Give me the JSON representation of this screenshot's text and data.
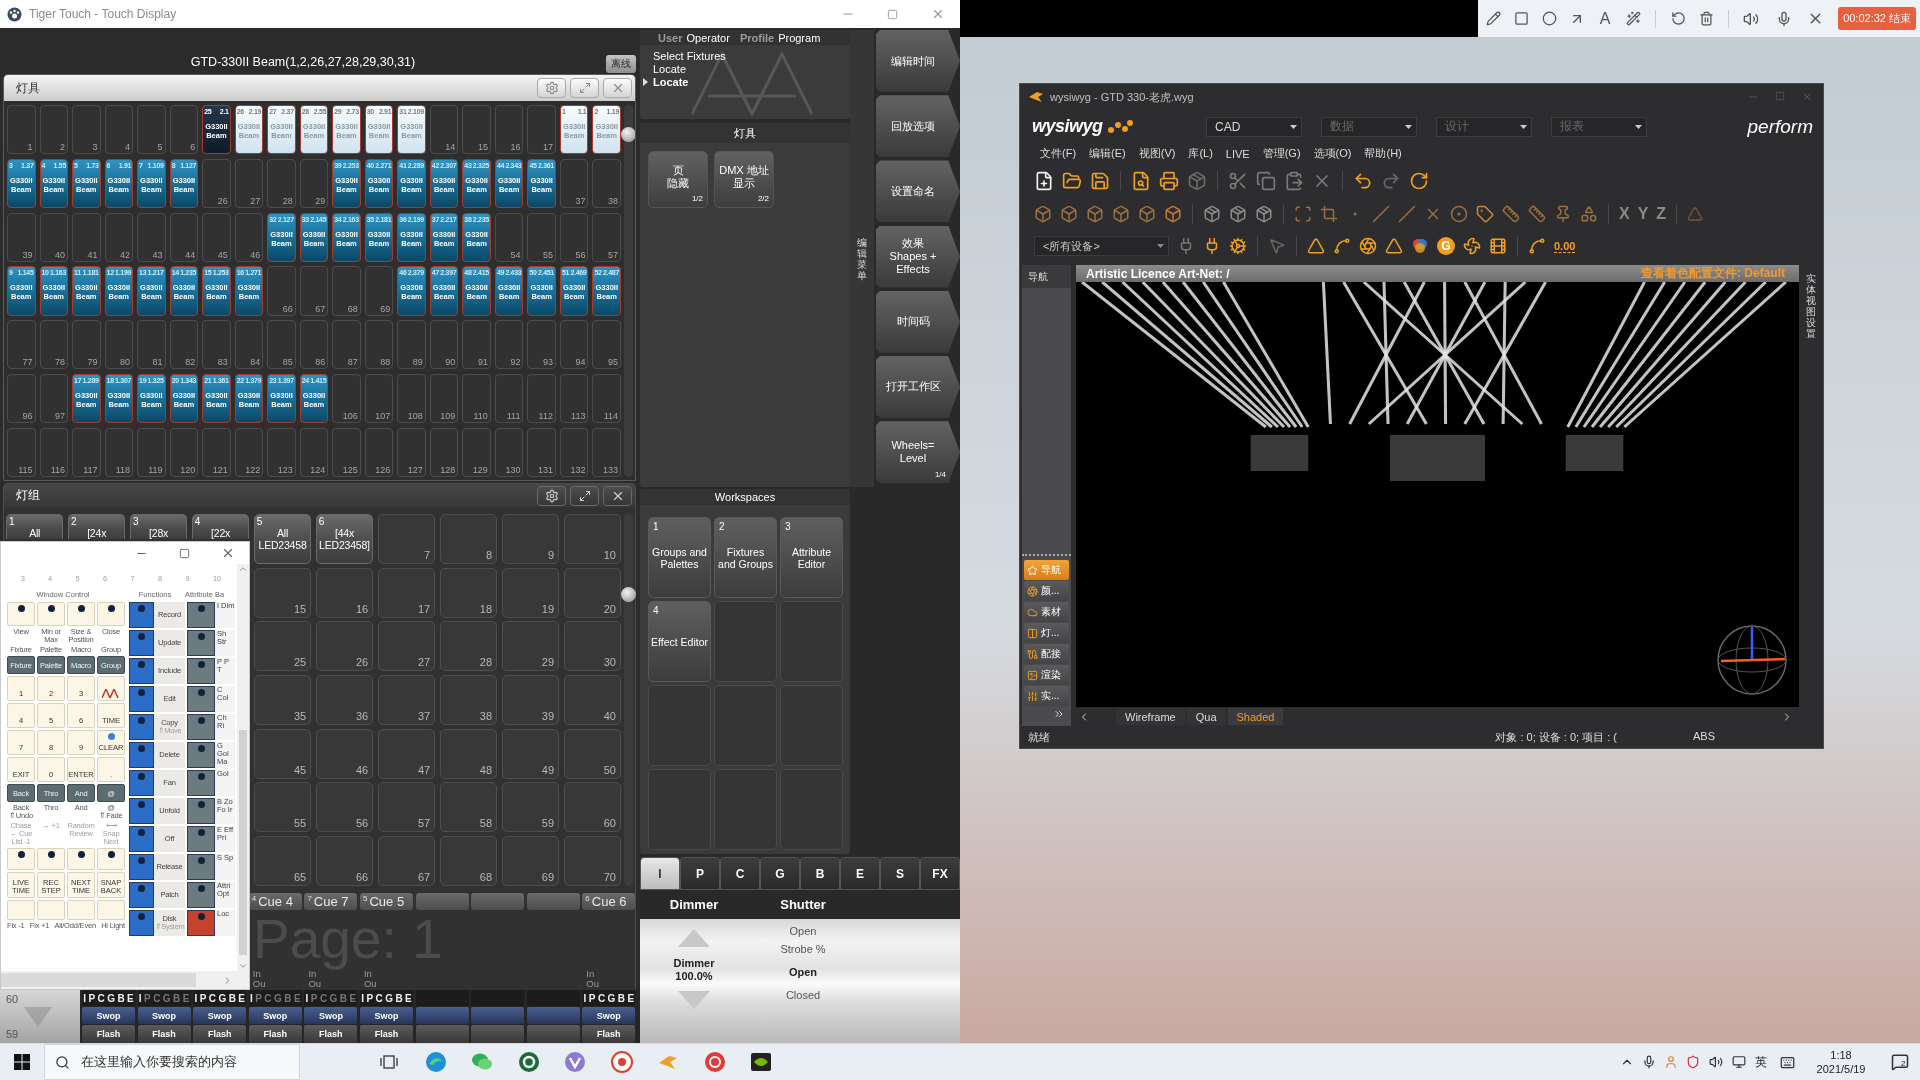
{
  "app_window": {
    "title": "Tiger Touch - Touch Display",
    "selection": "GTD-330II Beam(1,2,26,27,28,29,30,31)",
    "offline_button": "离线"
  },
  "fixtures_window": {
    "title": "灯具",
    "cells": [
      {
        "kind": "empty",
        "number": "1"
      },
      {
        "kind": "empty",
        "number": "2"
      },
      {
        "kind": "empty",
        "number": "3"
      },
      {
        "kind": "empty",
        "number": "4"
      },
      {
        "kind": "empty",
        "number": "5"
      },
      {
        "kind": "empty",
        "number": "6"
      },
      {
        "kind": "fixture",
        "id": "25",
        "address": "2.1",
        "type": "G330II",
        "mode": "Beam",
        "selected": false,
        "current": true
      },
      {
        "kind": "fixture",
        "id": "26",
        "address": "2.19",
        "type": "G330II",
        "mode": "Beam",
        "selected": true,
        "current": false
      },
      {
        "kind": "fixture",
        "id": "27",
        "address": "2.37",
        "type": "G330II",
        "mode": "Beam",
        "selected": true,
        "current": false
      },
      {
        "kind": "fixture",
        "id": "28",
        "address": "2.55",
        "type": "G330II",
        "mode": "Beam",
        "selected": true,
        "current": false
      },
      {
        "kind": "fixture",
        "id": "29",
        "address": "2.73",
        "type": "G330II",
        "mode": "Beam",
        "selected": true,
        "current": false
      },
      {
        "kind": "fixture",
        "id": "30",
        "address": "2.91",
        "type": "G330II",
        "mode": "Beam",
        "selected": true,
        "current": false
      },
      {
        "kind": "fixture",
        "id": "31",
        "address": "2.109",
        "type": "G330II",
        "mode": "Beam",
        "selected": true,
        "current": false
      },
      {
        "kind": "empty",
        "number": "14"
      },
      {
        "kind": "empty",
        "number": "15"
      },
      {
        "kind": "empty",
        "number": "16"
      },
      {
        "kind": "empty",
        "number": "17"
      },
      {
        "kind": "fixture",
        "id": "1",
        "address": "1.1",
        "type": "G330II",
        "mode": "Beam",
        "selected": true,
        "current": false
      },
      {
        "kind": "fixture",
        "id": "2",
        "address": "1.19",
        "type": "G330II",
        "mode": "Beam",
        "selected": true,
        "current": false
      },
      {
        "kind": "fixture",
        "id": "3",
        "address": "1.37",
        "type": "G330II",
        "mode": "Beam",
        "selected": false,
        "current": false
      },
      {
        "kind": "fixture",
        "id": "4",
        "address": "1.55",
        "type": "G330II",
        "mode": "Beam",
        "selected": false,
        "current": false
      },
      {
        "kind": "fixture",
        "id": "5",
        "address": "1.73",
        "type": "G330II",
        "mode": "Beam",
        "selected": false,
        "current": false
      },
      {
        "kind": "fixture",
        "id": "6",
        "address": "1.91",
        "type": "G330II",
        "mode": "Beam",
        "selected": false,
        "current": false
      },
      {
        "kind": "fixture",
        "id": "7",
        "address": "1.109",
        "type": "G330II",
        "mode": "Beam",
        "selected": false,
        "current": false
      },
      {
        "kind": "fixture",
        "id": "8",
        "address": "1.127",
        "type": "G330II",
        "mode": "Beam",
        "selected": false,
        "current": false
      },
      {
        "kind": "empty",
        "number": "26"
      },
      {
        "kind": "empty",
        "number": "27"
      },
      {
        "kind": "empty",
        "number": "28"
      },
      {
        "kind": "empty",
        "number": "29"
      },
      {
        "kind": "fixture",
        "id": "39",
        "address": "2.253",
        "type": "G330II",
        "mode": "Beam",
        "selected": false,
        "current": false
      },
      {
        "kind": "fixture",
        "id": "40",
        "address": "2.271",
        "type": "G330II",
        "mode": "Beam",
        "selected": false,
        "current": false
      },
      {
        "kind": "fixture",
        "id": "41",
        "address": "2.289",
        "type": "G330II",
        "mode": "Beam",
        "selected": false,
        "current": false
      },
      {
        "kind": "fixture",
        "id": "42",
        "address": "2.307",
        "type": "G330II",
        "mode": "Beam",
        "selected": false,
        "current": false
      },
      {
        "kind": "fixture",
        "id": "43",
        "address": "2.325",
        "type": "G330II",
        "mode": "Beam",
        "selected": false,
        "current": false
      },
      {
        "kind": "fixture",
        "id": "44",
        "address": "2.343",
        "type": "G330II",
        "mode": "Beam",
        "selected": false,
        "current": false
      },
      {
        "kind": "fixture",
        "id": "45",
        "address": "2.361",
        "type": "G330II",
        "mode": "Beam",
        "selected": false,
        "current": false
      },
      {
        "kind": "empty",
        "number": "37"
      },
      {
        "kind": "empty",
        "number": "38"
      },
      {
        "kind": "empty",
        "number": "39"
      },
      {
        "kind": "empty",
        "number": "40"
      },
      {
        "kind": "empty",
        "number": "41"
      },
      {
        "kind": "empty",
        "number": "42"
      },
      {
        "kind": "empty",
        "number": "43"
      },
      {
        "kind": "empty",
        "number": "44"
      },
      {
        "kind": "empty",
        "number": "45"
      },
      {
        "kind": "empty",
        "number": "46"
      },
      {
        "kind": "fixture",
        "id": "32",
        "address": "2.127",
        "type": "G330II",
        "mode": "Beam",
        "selected": false,
        "current": false
      },
      {
        "kind": "fixture",
        "id": "33",
        "address": "2.145",
        "type": "G330II",
        "mode": "Beam",
        "selected": false,
        "current": false
      },
      {
        "kind": "fixture",
        "id": "34",
        "address": "2.163",
        "type": "G330II",
        "mode": "Beam",
        "selected": false,
        "current": false
      },
      {
        "kind": "fixture",
        "id": "35",
        "address": "2.181",
        "type": "G330II",
        "mode": "Beam",
        "selected": false,
        "current": false
      },
      {
        "kind": "fixture",
        "id": "36",
        "address": "2.199",
        "type": "G330II",
        "mode": "Beam",
        "selected": false,
        "current": false
      },
      {
        "kind": "fixture",
        "id": "37",
        "address": "2.217",
        "type": "G330II",
        "mode": "Beam",
        "selected": false,
        "current": false
      },
      {
        "kind": "fixture",
        "id": "38",
        "address": "2.235",
        "type": "G330II",
        "mode": "Beam",
        "selected": false,
        "current": false
      },
      {
        "kind": "empty",
        "number": "54"
      },
      {
        "kind": "empty",
        "number": "55"
      },
      {
        "kind": "empty",
        "number": "56"
      },
      {
        "kind": "empty",
        "number": "57"
      },
      {
        "kind": "fixture",
        "id": "9",
        "address": "1.145",
        "type": "G330II",
        "mode": "Beam",
        "selected": false,
        "current": false
      },
      {
        "kind": "fixture",
        "id": "10",
        "address": "1.163",
        "type": "G330II",
        "mode": "Beam",
        "selected": false,
        "current": false
      },
      {
        "kind": "fixture",
        "id": "11",
        "address": "1.181",
        "type": "G330II",
        "mode": "Beam",
        "selected": false,
        "current": false
      },
      {
        "kind": "fixture",
        "id": "12",
        "address": "1.199",
        "type": "G330II",
        "mode": "Beam",
        "selected": false,
        "current": false
      },
      {
        "kind": "fixture",
        "id": "13",
        "address": "1.217",
        "type": "G330II",
        "mode": "Beam",
        "selected": false,
        "current": false
      },
      {
        "kind": "fixture",
        "id": "14",
        "address": "1.235",
        "type": "G330II",
        "mode": "Beam",
        "selected": false,
        "current": false
      },
      {
        "kind": "fixture",
        "id": "15",
        "address": "1.253",
        "type": "G330II",
        "mode": "Beam",
        "selected": false,
        "current": false
      },
      {
        "kind": "fixture",
        "id": "16",
        "address": "1.271",
        "type": "G330II",
        "mode": "Beam",
        "selected": false,
        "current": false
      },
      {
        "kind": "empty",
        "number": "66"
      },
      {
        "kind": "empty",
        "number": "67"
      },
      {
        "kind": "empty",
        "number": "68"
      },
      {
        "kind": "empty",
        "number": "69"
      },
      {
        "kind": "fixture",
        "id": "46",
        "address": "2.379",
        "type": "G330II",
        "mode": "Beam",
        "selected": false,
        "current": false
      },
      {
        "kind": "fixture",
        "id": "47",
        "address": "2.397",
        "type": "G330II",
        "mode": "Beam",
        "selected": false,
        "current": false
      },
      {
        "kind": "fixture",
        "id": "48",
        "address": "2.415",
        "type": "G330II",
        "mode": "Beam",
        "selected": false,
        "current": false
      },
      {
        "kind": "fixture",
        "id": "49",
        "address": "2.433",
        "type": "G330II",
        "mode": "Beam",
        "selected": false,
        "current": false
      },
      {
        "kind": "fixture",
        "id": "50",
        "address": "2.451",
        "type": "G330II",
        "mode": "Beam",
        "selected": false,
        "current": false
      },
      {
        "kind": "fixture",
        "id": "51",
        "address": "2.469",
        "type": "G330II",
        "mode": "Beam",
        "selected": false,
        "current": false
      },
      {
        "kind": "fixture",
        "id": "52",
        "address": "2.487",
        "type": "G330II",
        "mode": "Beam",
        "selected": false,
        "current": false
      },
      {
        "kind": "empty",
        "number": "77"
      },
      {
        "kind": "empty",
        "number": "78"
      },
      {
        "kind": "empty",
        "number": "79"
      },
      {
        "kind": "empty",
        "number": "80"
      },
      {
        "kind": "empty",
        "number": "81"
      },
      {
        "kind": "empty",
        "number": "82"
      },
      {
        "kind": "empty",
        "number": "83"
      },
      {
        "kind": "empty",
        "number": "84"
      },
      {
        "kind": "empty",
        "number": "85"
      },
      {
        "kind": "empty",
        "number": "86"
      },
      {
        "kind": "empty",
        "number": "87"
      },
      {
        "kind": "empty",
        "number": "88"
      },
      {
        "kind": "empty",
        "number": "89"
      },
      {
        "kind": "empty",
        "number": "90"
      },
      {
        "kind": "empty",
        "number": "91"
      },
      {
        "kind": "empty",
        "number": "92"
      },
      {
        "kind": "empty",
        "number": "93"
      },
      {
        "kind": "empty",
        "number": "94"
      },
      {
        "kind": "empty",
        "number": "95"
      },
      {
        "kind": "empty",
        "number": "96"
      },
      {
        "kind": "empty",
        "number": "97"
      },
      {
        "kind": "fixture",
        "id": "17",
        "address": "1.289",
        "type": "G330II",
        "mode": "Beam",
        "selected": false,
        "current": false
      },
      {
        "kind": "fixture",
        "id": "18",
        "address": "1.307",
        "type": "G330II",
        "mode": "Beam",
        "selected": false,
        "current": false
      },
      {
        "kind": "fixture",
        "id": "19",
        "address": "1.325",
        "type": "G330II",
        "mode": "Beam",
        "selected": false,
        "current": false
      },
      {
        "kind": "fixture",
        "id": "20",
        "address": "1.343",
        "type": "G330II",
        "mode": "Beam",
        "selected": false,
        "current": false
      },
      {
        "kind": "fixture",
        "id": "21",
        "address": "1.361",
        "type": "G330II",
        "mode": "Beam",
        "selected": false,
        "current": false
      },
      {
        "kind": "fixture",
        "id": "22",
        "address": "1.379",
        "type": "G330II",
        "mode": "Beam",
        "selected": false,
        "current": false
      },
      {
        "kind": "fixture",
        "id": "23",
        "address": "1.397",
        "type": "G330II",
        "mode": "Beam",
        "selected": false,
        "current": false
      },
      {
        "kind": "fixture",
        "id": "24",
        "address": "1.415",
        "type": "G330II",
        "mode": "Beam",
        "selected": false,
        "current": false
      },
      {
        "kind": "empty",
        "number": "106"
      },
      {
        "kind": "empty",
        "number": "107"
      },
      {
        "kind": "empty",
        "number": "108"
      },
      {
        "kind": "empty",
        "number": "109"
      },
      {
        "kind": "empty",
        "number": "110"
      },
      {
        "kind": "empty",
        "number": "111"
      },
      {
        "kind": "empty",
        "number": "112"
      },
      {
        "kind": "empty",
        "number": "113"
      },
      {
        "kind": "empty",
        "number": "114"
      },
      {
        "kind": "empty",
        "number": "115"
      },
      {
        "kind": "empty",
        "number": "116"
      },
      {
        "kind": "empty",
        "number": "117"
      },
      {
        "kind": "empty",
        "number": "118"
      },
      {
        "kind": "empty",
        "number": "119"
      },
      {
        "kind": "empty",
        "number": "120"
      },
      {
        "kind": "empty",
        "number": "121"
      },
      {
        "kind": "empty",
        "number": "122"
      },
      {
        "kind": "empty",
        "number": "123"
      },
      {
        "kind": "empty",
        "number": "124"
      },
      {
        "kind": "empty",
        "number": "125"
      },
      {
        "kind": "empty",
        "number": "126"
      },
      {
        "kind": "empty",
        "number": "127"
      },
      {
        "kind": "empty",
        "number": "128"
      },
      {
        "kind": "empty",
        "number": "129"
      },
      {
        "kind": "empty",
        "number": "130"
      },
      {
        "kind": "empty",
        "number": "131"
      },
      {
        "kind": "empty",
        "number": "132"
      },
      {
        "kind": "empty",
        "number": "133"
      }
    ]
  },
  "groups_window": {
    "title": "灯组",
    "rows": [
      [
        {
          "kind": "group",
          "number": "1",
          "name": "All"
        },
        {
          "kind": "group",
          "number": "2",
          "name": "[24x"
        },
        {
          "kind": "group",
          "number": "3",
          "name": "[28x"
        },
        {
          "kind": "group",
          "number": "4",
          "name": "[22x"
        },
        {
          "kind": "group",
          "number": "5",
          "name": "All LED23458"
        },
        {
          "kind": "group",
          "number": "6",
          "name": "[44x LED23458]"
        },
        {
          "kind": "empty",
          "number": "7"
        },
        {
          "kind": "empty",
          "number": "8"
        },
        {
          "kind": "empty",
          "number": "9"
        },
        {
          "kind": "empty",
          "number": "10"
        }
      ],
      [
        "",
        "",
        "",
        "",
        {
          "kind": "empty",
          "number": "15"
        },
        {
          "kind": "empty",
          "number": "16"
        },
        {
          "kind": "empty",
          "number": "17"
        },
        {
          "kind": "empty",
          "number": "18"
        },
        {
          "kind": "empty",
          "number": "19"
        },
        {
          "kind": "empty",
          "number": "20"
        }
      ],
      [
        "",
        "",
        "",
        "",
        {
          "kind": "empty",
          "number": "25"
        },
        {
          "kind": "empty",
          "number": "26"
        },
        {
          "kind": "empty",
          "number": "27"
        },
        {
          "kind": "empty",
          "number": "28"
        },
        {
          "kind": "empty",
          "number": "29"
        },
        {
          "kind": "empty",
          "number": "30"
        }
      ],
      [
        "",
        "",
        "",
        "",
        {
          "kind": "empty",
          "number": "35"
        },
        {
          "kind": "empty",
          "number": "36"
        },
        {
          "kind": "empty",
          "number": "37"
        },
        {
          "kind": "empty",
          "number": "38"
        },
        {
          "kind": "empty",
          "number": "39"
        },
        {
          "kind": "empty",
          "number": "40"
        }
      ],
      [
        "",
        "",
        "",
        "",
        {
          "kind": "empty",
          "number": "45"
        },
        {
          "kind": "empty",
          "number": "46"
        },
        {
          "kind": "empty",
          "number": "47"
        },
        {
          "kind": "empty",
          "number": "48"
        },
        {
          "kind": "empty",
          "number": "49"
        },
        {
          "kind": "empty",
          "number": "50"
        }
      ],
      [
        "",
        "",
        "",
        "",
        {
          "kind": "empty",
          "number": "55"
        },
        {
          "kind": "empty",
          "number": "56"
        },
        {
          "kind": "empty",
          "number": "57"
        },
        {
          "kind": "empty",
          "number": "58"
        },
        {
          "kind": "empty",
          "number": "59"
        },
        {
          "kind": "empty",
          "number": "60"
        }
      ],
      [
        "",
        "",
        "",
        "",
        {
          "kind": "empty",
          "number": "65"
        },
        {
          "kind": "empty",
          "number": "66"
        },
        {
          "kind": "empty",
          "number": "67"
        },
        {
          "kind": "empty",
          "number": "68"
        },
        {
          "kind": "empty",
          "number": "69"
        },
        {
          "kind": "empty",
          "number": "70"
        }
      ]
    ],
    "page_label": "Page: 1",
    "page_numbers": [
      "60",
      "59"
    ],
    "faders": [
      {
        "kind": "assigned",
        "letters": [
          {
            "letter": "I",
            "on": true
          },
          {
            "letter": "P",
            "on": true
          },
          {
            "letter": "C",
            "on": true
          },
          {
            "letter": "G",
            "on": true
          },
          {
            "letter": "B",
            "on": true
          },
          {
            "letter": "E",
            "on": true
          }
        ],
        "swop": "Swop",
        "flash": "Flash"
      },
      {
        "kind": "assigned",
        "letters": [
          {
            "letter": "I",
            "on": true
          },
          {
            "letter": "P",
            "on": false
          },
          {
            "letter": "C",
            "on": false
          },
          {
            "letter": "G",
            "on": false
          },
          {
            "letter": "B",
            "on": false
          },
          {
            "letter": "E",
            "on": false
          }
        ],
        "swop": "Swop",
        "flash": "Flash"
      },
      {
        "kind": "assigned",
        "letters": [
          {
            "letter": "I",
            "on": true
          },
          {
            "letter": "P",
            "on": true
          },
          {
            "letter": "C",
            "on": true
          },
          {
            "letter": "G",
            "on": true
          },
          {
            "letter": "B",
            "on": true
          },
          {
            "letter": "E",
            "on": true
          }
        ],
        "swop": "Swop",
        "flash": "Flash"
      },
      {
        "kind": "assigned",
        "cue_number": "4",
        "cue": "Cue 4",
        "in_out": [
          "In",
          "Ou"
        ],
        "letters": [
          {
            "letter": "I",
            "on": true
          },
          {
            "letter": "P",
            "on": false
          },
          {
            "letter": "C",
            "on": false
          },
          {
            "letter": "G",
            "on": false
          },
          {
            "letter": "B",
            "on": false
          },
          {
            "letter": "E",
            "on": false
          }
        ],
        "swop": "Swop",
        "flash": "Flash"
      },
      {
        "kind": "assigned",
        "cue_number": "7",
        "cue": "Cue 7",
        "in_out": [
          "In",
          "Ou"
        ],
        "letters": [
          {
            "letter": "I",
            "on": true
          },
          {
            "letter": "P",
            "on": false
          },
          {
            "letter": "C",
            "on": false
          },
          {
            "letter": "G",
            "on": false
          },
          {
            "letter": "B",
            "on": false
          },
          {
            "letter": "E",
            "on": false
          }
        ],
        "swop": "Swop",
        "flash": "Flash"
      },
      {
        "kind": "assigned",
        "cue_number": "5",
        "cue": "Cue 5",
        "in_out": [
          "In",
          "Ou"
        ],
        "letters": [
          {
            "letter": "I",
            "on": true
          },
          {
            "letter": "P",
            "on": true
          },
          {
            "letter": "C",
            "on": true
          },
          {
            "letter": "G",
            "on": true
          },
          {
            "letter": "B",
            "on": true
          },
          {
            "letter": "E",
            "on": true
          }
        ],
        "swop": "Swop",
        "flash": "Flash"
      },
      {
        "kind": "empty"
      },
      {
        "kind": "empty"
      },
      {
        "kind": "empty"
      },
      {
        "kind": "assigned",
        "cue_number": "6",
        "cue": "Cue 6",
        "in_out": [
          "In",
          "Ou"
        ],
        "letters": [
          {
            "letter": "I",
            "on": true
          },
          {
            "letter": "P",
            "on": true
          },
          {
            "letter": "C",
            "on": true
          },
          {
            "letter": "G",
            "on": true
          },
          {
            "letter": "B",
            "on": true
          },
          {
            "letter": "E",
            "on": true
          }
        ],
        "swop": "Swop",
        "flash": "Flash"
      }
    ]
  },
  "console_panel": {
    "bank_numbers": [
      "3",
      "4",
      "5",
      "6",
      "7",
      "8",
      "9",
      "10"
    ],
    "sections": [
      "Window Control",
      "Functions",
      "Attribute Ba"
    ],
    "window_labels": [
      "View",
      "Min or Max",
      "Size & Position",
      "Close"
    ],
    "mode_labels": [
      "Fixture",
      "Palette",
      "Macro",
      "Group"
    ],
    "mode_keys": [
      "Fixture",
      "Palette",
      "Macro",
      "Group"
    ],
    "keypad": [
      {
        "kind": "key",
        "label": "1",
        "led": false
      },
      {
        "kind": "key",
        "label": "2",
        "led": false
      },
      {
        "kind": "key",
        "label": "3",
        "led": false
      },
      {
        "kind": "logo",
        "led": false
      },
      {
        "kind": "key",
        "label": "4",
        "led": false
      },
      {
        "kind": "key",
        "label": "5",
        "led": false
      },
      {
        "kind": "key",
        "label": "6",
        "led": false
      },
      {
        "kind": "key",
        "label": "TIME",
        "led": false
      },
      {
        "kind": "key",
        "label": "7",
        "led": false
      },
      {
        "kind": "key",
        "label": "8",
        "led": false
      },
      {
        "kind": "key",
        "label": "9",
        "led": false
      },
      {
        "kind": "key",
        "label": "CLEAR",
        "led": true
      },
      {
        "kind": "key",
        "label": "EXIT",
        "led": false
      },
      {
        "kind": "key",
        "label": "0",
        "led": false
      },
      {
        "kind": "key",
        "label": "ENTER",
        "led": false
      },
      {
        "kind": "key",
        "label": ".",
        "led": false
      }
    ],
    "control_keys": [
      "Back",
      "Thro",
      "And",
      "@"
    ],
    "control_labels": [
      "Back ⇑Undo",
      "Thro",
      "And",
      "@ ⇑Fade"
    ],
    "hint_labels": [
      "Chase ← Cue List -1",
      "→ +1",
      "Random Review",
      "⟷ Snap Next"
    ],
    "time_keys": [
      "LIVE TIME",
      "REC STEP",
      "NEXT TIME",
      "SNAP BACK"
    ],
    "fix_labels": [
      "Fix -1",
      "Fix +1",
      "All/Odd/Even",
      "Hi Light"
    ],
    "functions": [
      {
        "label": "Record"
      },
      {
        "label": "Update"
      },
      {
        "label": "Include"
      },
      {
        "label": "Edit"
      },
      {
        "label": "Copy",
        "hint": "⇑Move"
      },
      {
        "label": "Delete"
      },
      {
        "label": "Fan"
      },
      {
        "label": "Unfold"
      },
      {
        "label": "Off"
      },
      {
        "label": "Release"
      },
      {
        "label": "Patch"
      },
      {
        "label": "Disk",
        "hint": "⇑System"
      }
    ],
    "attributes": [
      {
        "letter": "I",
        "label": "Dim",
        "color": "#6b7b80"
      },
      {
        "label": "Sh Str",
        "color": "#6b7b80"
      },
      {
        "letter": "P",
        "label": "P T",
        "color": "#6b7b80"
      },
      {
        "letter": "C",
        "label": "Col",
        "color": "#6b7b80"
      },
      {
        "label": "Ch Ri",
        "color": "#6b7b80"
      },
      {
        "letter": "G",
        "label": "Gol Ma",
        "color": "#6b7b80"
      },
      {
        "label": "Gol",
        "color": "#6b7b80"
      },
      {
        "letter": "B",
        "label": "Zo Fo Ir",
        "color": "#6b7b80"
      },
      {
        "letter": "E",
        "label": "Eff Pri",
        "color": "#6b7b80"
      },
      {
        "letter": "S",
        "label": "Sp",
        "color": "#6b7b80"
      },
      {
        "label": "Attri Opt",
        "color": "#6b7b80"
      },
      {
        "label": "Loc",
        "color": "#c4432e"
      }
    ]
  },
  "menu_panel": {
    "fields": [
      {
        "label": "User",
        "value": "Operator"
      },
      {
        "label": "Profile",
        "value": "Program"
      }
    ],
    "lines": [
      {
        "text": "Select Fixtures",
        "current": false
      },
      {
        "text": "Locate",
        "current": false
      },
      {
        "text": "Locate",
        "current": true
      }
    ]
  },
  "options_panel": {
    "title": "灯具",
    "buttons": [
      {
        "lines": [
          "页",
          "隐藏"
        ],
        "page": "1/2"
      },
      {
        "lines": [
          "DMX 地址",
          "显示"
        ],
        "page": "2/2"
      }
    ]
  },
  "vertical_label": "编辑菜单",
  "softkeys": [
    {
      "lines": [
        "编辑时间"
      ]
    },
    {
      "lines": [
        "回放选项"
      ]
    },
    {
      "lines": [
        "设置命名"
      ]
    },
    {
      "lines": [
        "效果",
        "Shapes +",
        "Effects"
      ]
    },
    {
      "lines": [
        "时间码"
      ]
    },
    {
      "lines": [
        "打开工作区"
      ]
    },
    {
      "lines": [
        "Wheels=",
        "Level"
      ],
      "page": "1/4"
    }
  ],
  "workspaces": {
    "title": "Workspaces",
    "buttons": [
      {
        "kind": "workspace",
        "number": "1",
        "label": "Groups and Palettes"
      },
      {
        "kind": "workspace",
        "number": "2",
        "label": "Fixtures and Groups"
      },
      {
        "kind": "workspace",
        "number": "3",
        "label": "Attribute Editor"
      },
      {
        "kind": "workspace",
        "number": "4",
        "label": "Effect Editor"
      },
      {
        "kind": "empty"
      },
      {
        "kind": "empty"
      },
      {
        "kind": "empty"
      },
      {
        "kind": "empty"
      },
      {
        "kind": "empty"
      },
      {
        "kind": "empty"
      },
      {
        "kind": "empty"
      },
      {
        "kind": "empty"
      }
    ]
  },
  "attribute_tabs": [
    {
      "label": "I",
      "selected": true
    },
    {
      "label": "P",
      "selected": false
    },
    {
      "label": "C",
      "selected": false
    },
    {
      "label": "G",
      "selected": false
    },
    {
      "label": "B",
      "selected": false
    },
    {
      "label": "E",
      "selected": false
    },
    {
      "label": "S",
      "selected": false
    },
    {
      "label": "FX",
      "selected": false
    }
  ],
  "wheels": [
    {
      "kind": "level",
      "title": "Dimmer",
      "label": "Dimmer",
      "value": "100.0%"
    },
    {
      "kind": "list",
      "title": "Shutter",
      "options": [
        {
          "label": "Open",
          "selected": false
        },
        {
          "label": "Strobe %",
          "selected": false
        },
        {
          "label": "Open",
          "selected": true
        },
        {
          "label": "Closed",
          "selected": false
        }
      ]
    }
  ],
  "wysiwyg": {
    "title": "wysiwyg - GTD 330-老虎.wyg",
    "logo": "wysiwyg",
    "modes": [
      {
        "label": "CAD",
        "selected": true
      },
      {
        "label": "数据",
        "selected": false
      },
      {
        "label": "设计",
        "selected": false
      },
      {
        "label": "报表",
        "selected": false
      }
    ],
    "brand": "perform",
    "menu": [
      "文件(F)",
      "编辑(E)",
      "视图(V)",
      "库(L)",
      "LIVE",
      "管理(G)",
      "选项(O)",
      "帮助(H)"
    ],
    "axis_labels": [
      "X",
      "Y",
      "Z"
    ],
    "device_filter": "<所有设备>",
    "g_label": "G",
    "zero_label": "0.00",
    "nav_title": "导航",
    "nav_items": [
      {
        "label": "导航",
        "selected": true
      },
      {
        "label": "颜...",
        "selected": false
      },
      {
        "label": "素材",
        "selected": false
      },
      {
        "label": "灯...",
        "selected": false
      },
      {
        "label": "配接",
        "selected": false
      },
      {
        "label": "渲染",
        "selected": false
      },
      {
        "label": "实...",
        "selected": false
      }
    ],
    "viewport_title": "Artistic Licence Art-Net: /",
    "shading_profile": "查看着色配置文件: Default",
    "side_tab": "实体视图设置",
    "view_tabs": [
      {
        "label": "Wireframe",
        "selected": false
      },
      {
        "label": "Qua",
        "selected": false
      },
      {
        "label": "Shaded",
        "selected": true
      }
    ],
    "status": "就绪",
    "status_counts": "对象 : 0; 设备 : 0; 项目 : (",
    "status_mode": "ABS"
  },
  "recorder": {
    "text_tool": "A",
    "timer": "00:02:32 结束"
  },
  "taskbar": {
    "search_placeholder": "在这里输入你要搜索的内容",
    "input_language": "英",
    "time": "1:18",
    "date": "2021/5/19",
    "notification_count": "2"
  }
}
